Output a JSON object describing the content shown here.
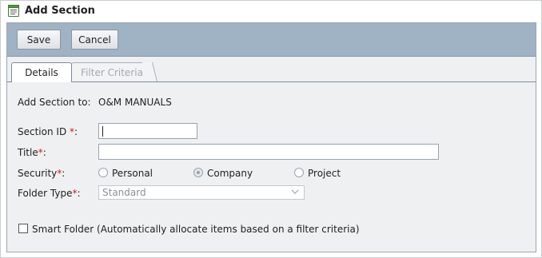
{
  "dialog": {
    "title": "Add Section",
    "title_icon": "document-form-icon"
  },
  "toolbar": {
    "save_label": "Save",
    "cancel_label": "Cancel"
  },
  "tabs": [
    {
      "label": "Details",
      "active": true
    },
    {
      "label": "Filter Criteria",
      "active": false
    }
  ],
  "form": {
    "add_section_to_label": "Add Section to:",
    "add_section_to_value": "O&M MANUALS",
    "section_id_label": "Section ID ",
    "section_id_req": "*",
    "section_id_colon": ":",
    "section_id_value": "",
    "title_label": "Title",
    "title_req": "*",
    "title_colon": ":",
    "title_value": "",
    "security_label": "Security",
    "security_req": "*",
    "security_colon": ":",
    "security_options": [
      {
        "label": "Personal",
        "checked": false
      },
      {
        "label": "Company",
        "checked": true
      },
      {
        "label": "Project",
        "checked": false
      }
    ],
    "folder_type_label": "Folder Type",
    "folder_type_req": "*",
    "folder_type_colon": ":",
    "folder_type_value": "Standard",
    "smart_folder_label": "Smart Folder (Automatically allocate items based on a filter criteria)",
    "smart_folder_checked": false
  },
  "colors": {
    "toolbar_bg": "#9fb3c4",
    "required_asterisk": "#d21a1a"
  }
}
